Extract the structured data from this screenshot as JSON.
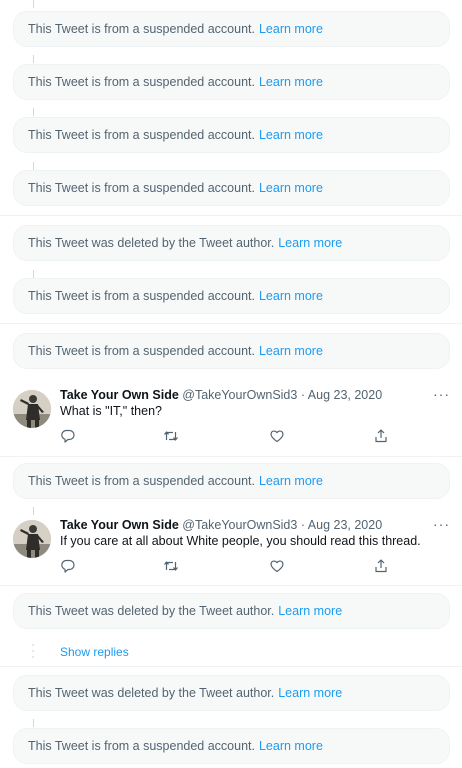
{
  "suspended_msg": "This Tweet is from a suspended account.",
  "deleted_msg": "This Tweet was deleted by the Tweet author.",
  "learn_more": "Learn more",
  "show_replies": "Show replies",
  "tweets": [
    {
      "name": "Take Your Own Side",
      "handle": "@TakeYourOwnSid3",
      "date": "· Aug 23, 2020",
      "text": "What is \"IT,\" then?",
      "more": "···"
    },
    {
      "name": "Take Your Own Side",
      "handle": "@TakeYourOwnSid3",
      "date": "· Aug 23, 2020",
      "text": "If you care at all about White people, you should read this thread.",
      "more": "···"
    }
  ],
  "icons": {
    "reply": "reply-icon",
    "retweet": "retweet-icon",
    "like": "like-icon",
    "share": "share-icon",
    "more": "more-icon"
  },
  "colors": {
    "link": "#1d9bf0",
    "muted": "#536471",
    "notice_bg": "#f7f9f9"
  }
}
